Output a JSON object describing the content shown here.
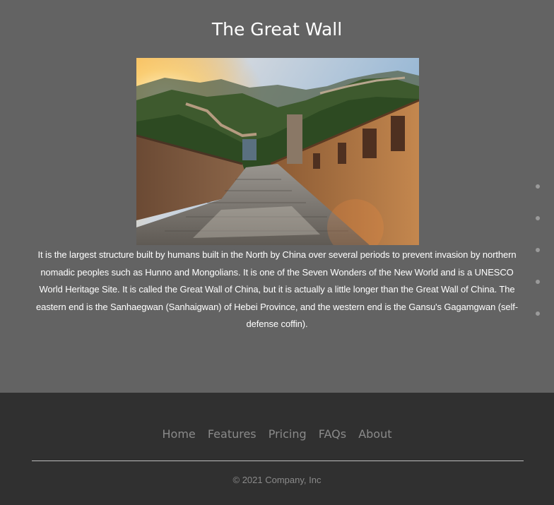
{
  "page": {
    "title": "The Great Wall",
    "image_alt": "The Great Wall",
    "description": "It is the largest structure built by humans built in the North by China over several periods to prevent invasion by northern nomadic peoples such as Hunno and Mongolians. It is one of the Seven Wonders of the New World and is a UNESCO World Heritage Site. It is called the Great Wall of China, but it is actually a little longer than the Great Wall of China. The eastern end is the Sanhaegwan (Sanhaigwan) of Hebei Province, and the western end is the Gansu's Gagamgwan (self-defense coffin)."
  },
  "carousel": {
    "dot_count": 5
  },
  "footer": {
    "nav": [
      {
        "label": "Home"
      },
      {
        "label": "Features"
      },
      {
        "label": "Pricing"
      },
      {
        "label": "FAQs"
      },
      {
        "label": "About"
      }
    ],
    "copyright": "© 2021 Company, Inc"
  },
  "colors": {
    "main_bg": "#636363",
    "footer_bg": "#303030",
    "text": "#ffffff",
    "muted": "#8a8a8a"
  }
}
